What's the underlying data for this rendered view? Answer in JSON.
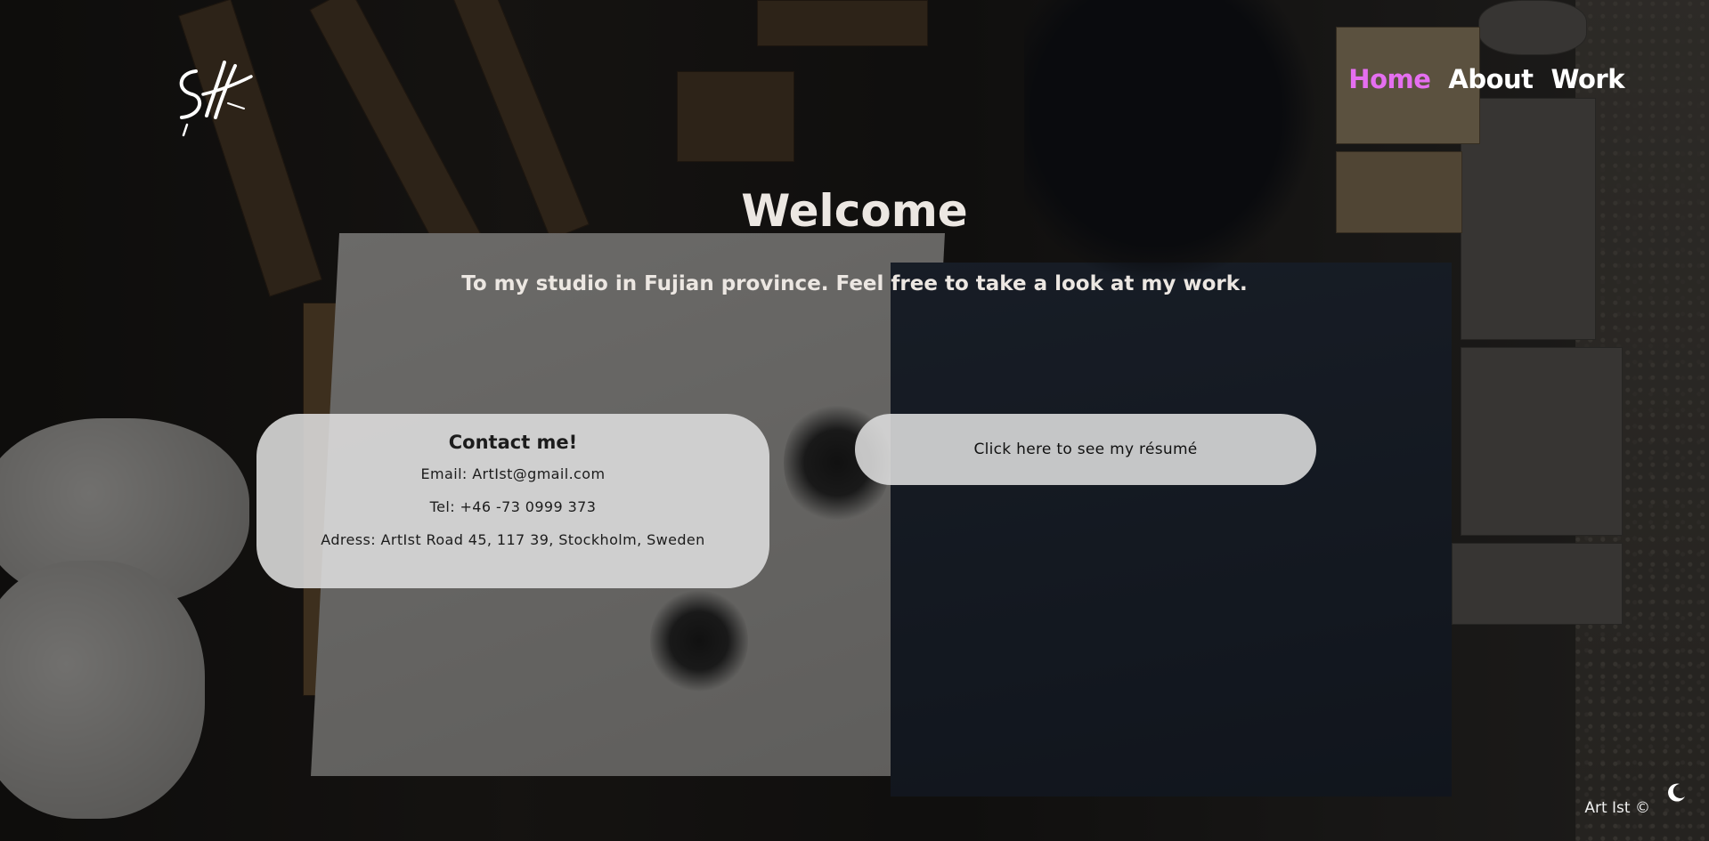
{
  "header": {
    "logo_alt": "ArtIst signature logo",
    "nav": [
      {
        "label": "Home",
        "active": true
      },
      {
        "label": "About",
        "active": false
      },
      {
        "label": "Work",
        "active": false
      }
    ]
  },
  "hero": {
    "title": "Welcome",
    "subtitle": "To my studio in Fujian province. Feel free to take a look at my work."
  },
  "contact": {
    "title": "Contact me!",
    "email": "Email: ArtIst@gmail.com",
    "tel": "Tel: +46 -73 0999 373",
    "address": "Adress: ArtIst Road 45, 117 39, Stockholm, Sweden"
  },
  "resume": {
    "label": "Click here to see my résumé"
  },
  "footer": {
    "copyright": "Art Ist ©",
    "theme_icon": "moon-icon"
  },
  "colors": {
    "active_nav": "#e56ff0",
    "nav_text": "#ffffff",
    "card_bg": "#dedede",
    "hero_text": "#ece7e2"
  }
}
